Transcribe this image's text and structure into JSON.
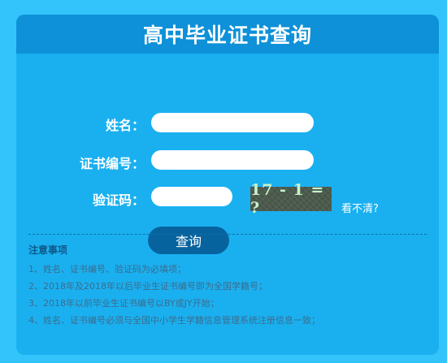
{
  "page": {
    "title": "高中毕业证书查询"
  },
  "form": {
    "name_label": "姓名：",
    "cert_no_label": "证书编号：",
    "captcha_label": "验证码：",
    "name_value": "",
    "cert_no_value": "",
    "captcha_value": "",
    "captcha_image_text": "17 - 1 = ?",
    "refresh_link": "看不清?",
    "submit_label": "查询"
  },
  "notes": {
    "title": "注意事项",
    "items": [
      "1、姓名、证书编号、验证码为必填项；",
      "2、2018年及2018年以后毕业生证书编号即为全国学籍号；",
      "3、2018年以前毕业生证书编号以BY或JY开始；",
      "4、姓名、证书编号必须与全国中小学生学籍信息管理系统注册信息一致；"
    ]
  },
  "colors": {
    "page_bg": "#33c4fb",
    "card_bg": "#1ab0f0",
    "header_bg": "#0e91d8",
    "button_bg": "#07639e"
  }
}
